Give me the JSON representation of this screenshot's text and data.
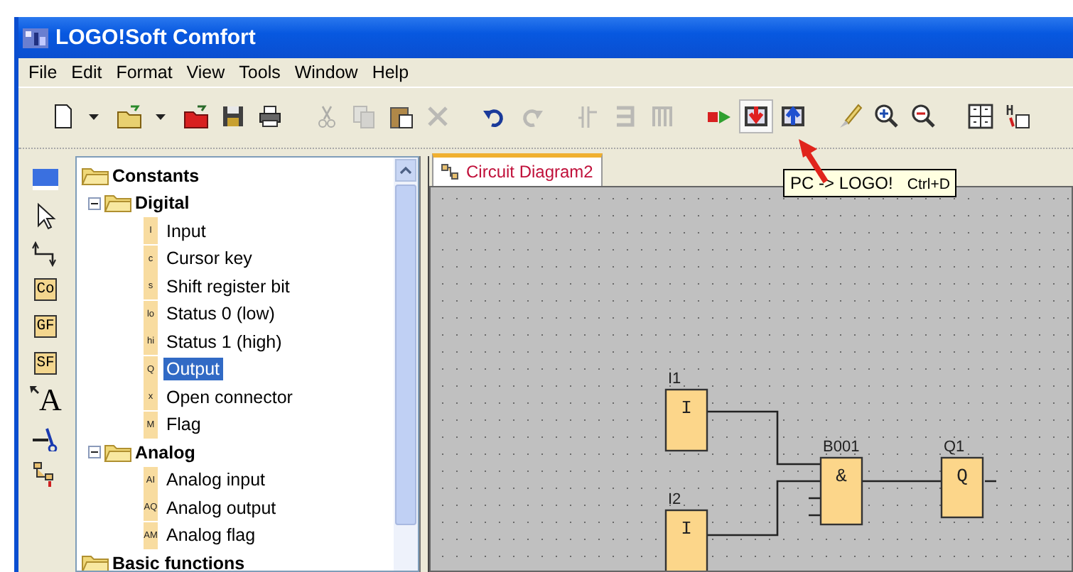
{
  "window": {
    "title": "LOGO!Soft Comfort"
  },
  "menu": [
    "File",
    "Edit",
    "Format",
    "View",
    "Tools",
    "Window",
    "Help"
  ],
  "toolbar": [
    {
      "kind": "new",
      "disabled": false,
      "hovered": false
    },
    {
      "kind": "dropdown",
      "disabled": false,
      "hovered": false
    },
    {
      "kind": "open",
      "disabled": false,
      "hovered": false
    },
    {
      "kind": "dropdown",
      "disabled": false,
      "hovered": false
    },
    {
      "kind": "open-red",
      "disabled": false,
      "hovered": false
    },
    {
      "kind": "save",
      "disabled": false,
      "hovered": false
    },
    {
      "kind": "print",
      "disabled": false,
      "hovered": false
    },
    {
      "kind": "cut",
      "disabled": true,
      "hovered": false
    },
    {
      "kind": "copy",
      "disabled": true,
      "hovered": false
    },
    {
      "kind": "paste",
      "disabled": false,
      "hovered": false
    },
    {
      "kind": "delete",
      "disabled": true,
      "hovered": false
    },
    {
      "kind": "undo",
      "disabled": false,
      "hovered": false
    },
    {
      "kind": "redo",
      "disabled": true,
      "hovered": false
    },
    {
      "kind": "ladder",
      "disabled": true,
      "hovered": false
    },
    {
      "kind": "bracket",
      "disabled": true,
      "hovered": false
    },
    {
      "kind": "frame",
      "disabled": true,
      "hovered": false
    },
    {
      "kind": "simulate",
      "disabled": false,
      "hovered": false
    },
    {
      "kind": "download",
      "disabled": false,
      "hovered": true
    },
    {
      "kind": "upload",
      "disabled": false,
      "hovered": false
    },
    {
      "kind": "brush",
      "disabled": false,
      "hovered": false
    },
    {
      "kind": "zoom-in",
      "disabled": false,
      "hovered": false
    },
    {
      "kind": "zoom-out",
      "disabled": false,
      "hovered": false
    },
    {
      "kind": "grid",
      "disabled": false,
      "hovered": false
    },
    {
      "kind": "network",
      "disabled": false,
      "hovered": false
    }
  ],
  "tooltip": {
    "label": "PC -> LOGO!",
    "shortcut": "Ctrl+D"
  },
  "tools": [
    {
      "kind": "select"
    },
    {
      "kind": "pointer"
    },
    {
      "kind": "connect"
    },
    {
      "kind": "block",
      "label": "Co"
    },
    {
      "kind": "block",
      "label": "GF"
    },
    {
      "kind": "block",
      "label": "SF"
    },
    {
      "kind": "text",
      "label": "A"
    },
    {
      "kind": "cut"
    },
    {
      "kind": "tree"
    }
  ],
  "tree": [
    {
      "label": "Constants",
      "children": [
        {
          "label": "Digital",
          "expanded": true,
          "children": [
            {
              "badge": "I",
              "label": "Input",
              "selected": false
            },
            {
              "badge": "c",
              "label": "Cursor key",
              "selected": false
            },
            {
              "badge": "s",
              "label": "Shift register bit",
              "selected": false
            },
            {
              "badge": "lo",
              "label": "Status 0 (low)",
              "selected": false
            },
            {
              "badge": "hi",
              "label": "Status 1 (high)",
              "selected": false
            },
            {
              "badge": "Q",
              "label": "Output",
              "selected": true
            },
            {
              "badge": "x",
              "label": "Open connector",
              "selected": false
            },
            {
              "badge": "M",
              "label": "Flag",
              "selected": false
            }
          ]
        },
        {
          "label": "Analog",
          "expanded": true,
          "children": [
            {
              "badge": "AI",
              "label": "Analog input",
              "selected": false
            },
            {
              "badge": "AQ",
              "label": "Analog output",
              "selected": false
            },
            {
              "badge": "AM",
              "label": "Analog flag",
              "selected": false
            }
          ]
        }
      ]
    },
    {
      "label": "Basic functions"
    }
  ],
  "tab": {
    "label": "Circuit Diagram2",
    "selected": true
  },
  "diagram": {
    "blocks": [
      {
        "name": "I1",
        "symbol": "I"
      },
      {
        "name": "I2",
        "symbol": "I"
      },
      {
        "name": "B001",
        "symbol": "&"
      },
      {
        "name": "Q1",
        "symbol": "Q"
      }
    ]
  }
}
